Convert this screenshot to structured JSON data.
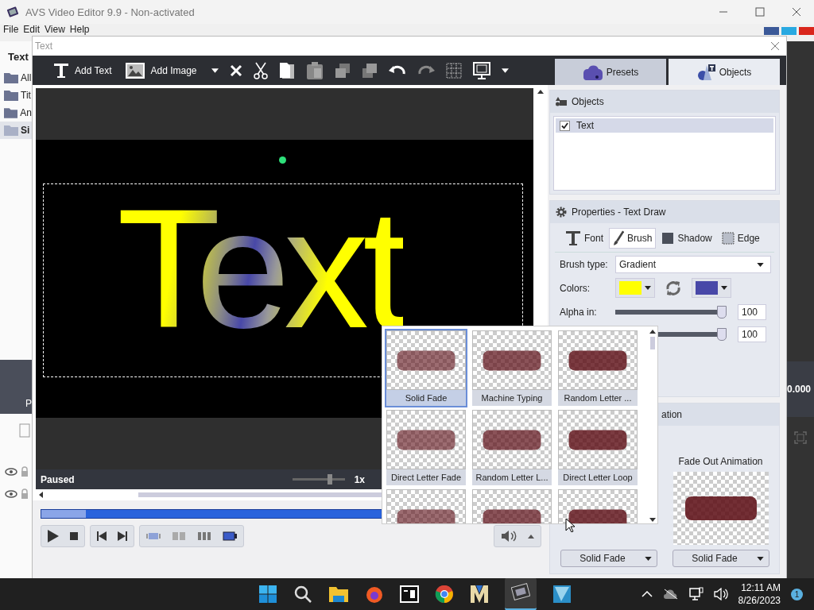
{
  "app": {
    "title": "AVS Video Editor 9.9 - Non-activated",
    "menu": [
      "File",
      "Edit",
      "View",
      "Help"
    ],
    "sidebar_heading": "Text",
    "sidebar_items": [
      {
        "label": "All",
        "selected": false
      },
      {
        "label": "Tit",
        "selected": false
      },
      {
        "label": "An",
        "selected": false
      },
      {
        "label": "Si",
        "selected": true
      }
    ],
    "sidebar_panel_text": "P",
    "timecode": "0.000"
  },
  "dialog": {
    "title": "Text",
    "toolbar": [
      {
        "label": "Add Text"
      },
      {
        "label": "Add Image"
      }
    ],
    "tabs": [
      {
        "label": "Presets",
        "selected": false
      },
      {
        "label": "Objects",
        "selected": true
      }
    ],
    "preview": {
      "canvas_text": "Text",
      "status": "Paused",
      "speed": "1x",
      "speed_slider": {
        "level": 0.72
      }
    },
    "objects": {
      "heading": "Objects",
      "items": [
        {
          "label": "Text",
          "checked": true,
          "selected": true
        }
      ]
    },
    "properties": {
      "heading": "Properties - Text Draw",
      "tabs": [
        {
          "label": "Font",
          "selected": false
        },
        {
          "label": "Brush",
          "selected": true
        },
        {
          "label": "Shadow",
          "selected": false
        },
        {
          "label": "Edge",
          "selected": false
        }
      ],
      "brush_type_label": "Brush type:",
      "brush_type": "Gradient",
      "colors_label": "Colors:",
      "colors": [
        {
          "color": "#ffff00"
        },
        {
          "color": "#4848a8"
        }
      ],
      "sliders": [
        {
          "label": "Alpha in:",
          "level": 1,
          "reading": "100"
        },
        {
          "level": 1,
          "reading": "100"
        }
      ]
    },
    "animation": {
      "heading": "ation",
      "fade_in": "Solid Fade",
      "fade_out_label": "Fade Out Animation",
      "fade_out": "Solid Fade"
    },
    "presets_popup": {
      "items": [
        {
          "label": "Solid Fade",
          "selected": true
        },
        {
          "label": "Machine Typing",
          "selected": false
        },
        {
          "label": "Random Letter ...",
          "selected": false
        },
        {
          "label": "Direct Letter Fade",
          "selected": false
        },
        {
          "label": "Random Letter L...",
          "selected": false
        },
        {
          "label": "Direct Letter Loop",
          "selected": false
        },
        {
          "selected": false
        },
        {
          "selected": false
        },
        {
          "selected": false
        }
      ]
    }
  },
  "taskbar": {
    "time": "12:11 AM",
    "date": "8/26/2023",
    "badge": "1"
  }
}
